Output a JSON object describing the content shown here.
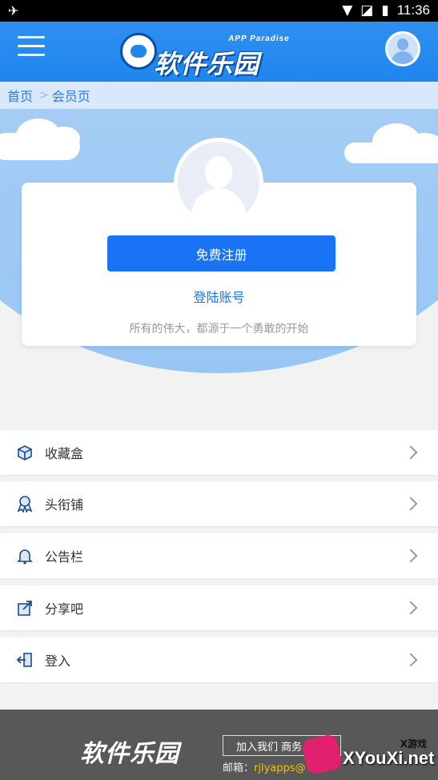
{
  "status_bar": {
    "time": "11:36"
  },
  "app_bar": {
    "logo_sub": "APP Paradise",
    "logo_main": "软件乐园"
  },
  "breadcrumb": {
    "home": "首页",
    "current": "会员页"
  },
  "card": {
    "register_label": "免费注册",
    "login_label": "登陆账号",
    "slogan": "所有的伟大，都源于一个勇敢的开始"
  },
  "menu": [
    {
      "label": "收藏盒",
      "icon": "box-icon"
    },
    {
      "label": "头衔铺",
      "icon": "ribbon-icon"
    },
    {
      "label": "公告栏",
      "icon": "bell-icon"
    },
    {
      "label": "分享吧",
      "icon": "share-icon"
    },
    {
      "label": "登入",
      "icon": "login-icon"
    }
  ],
  "footer": {
    "logo": "软件乐园",
    "join_label": "加入我们 商务",
    "mail_label": "邮箱：",
    "mail_addr": "rjlyapps@"
  },
  "watermark": {
    "small": "X游戏",
    "big": "XYouXi.net"
  }
}
